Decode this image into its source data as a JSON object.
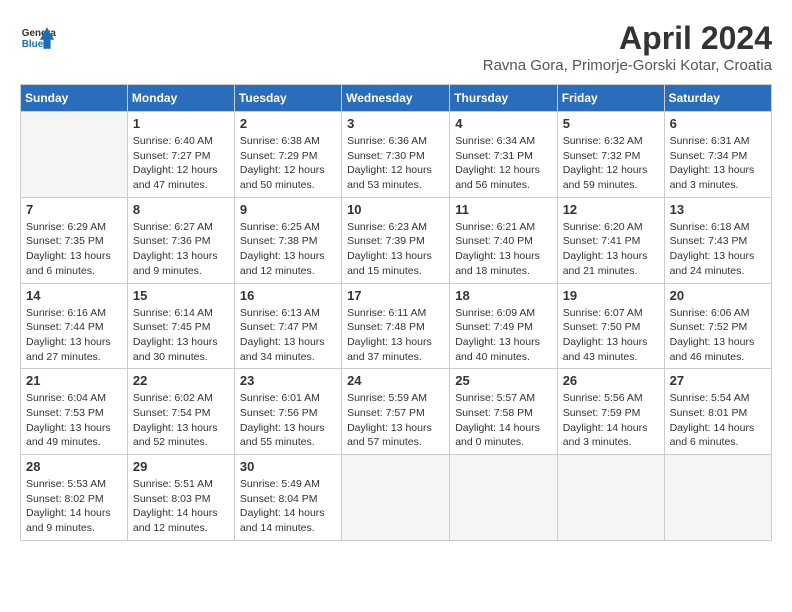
{
  "header": {
    "logo_line1": "General",
    "logo_line2": "Blue",
    "month": "April 2024",
    "location": "Ravna Gora, Primorje-Gorski Kotar, Croatia"
  },
  "days_of_week": [
    "Sunday",
    "Monday",
    "Tuesday",
    "Wednesday",
    "Thursday",
    "Friday",
    "Saturday"
  ],
  "weeks": [
    [
      {
        "day": "",
        "info": ""
      },
      {
        "day": "1",
        "info": "Sunrise: 6:40 AM\nSunset: 7:27 PM\nDaylight: 12 hours\nand 47 minutes."
      },
      {
        "day": "2",
        "info": "Sunrise: 6:38 AM\nSunset: 7:29 PM\nDaylight: 12 hours\nand 50 minutes."
      },
      {
        "day": "3",
        "info": "Sunrise: 6:36 AM\nSunset: 7:30 PM\nDaylight: 12 hours\nand 53 minutes."
      },
      {
        "day": "4",
        "info": "Sunrise: 6:34 AM\nSunset: 7:31 PM\nDaylight: 12 hours\nand 56 minutes."
      },
      {
        "day": "5",
        "info": "Sunrise: 6:32 AM\nSunset: 7:32 PM\nDaylight: 12 hours\nand 59 minutes."
      },
      {
        "day": "6",
        "info": "Sunrise: 6:31 AM\nSunset: 7:34 PM\nDaylight: 13 hours\nand 3 minutes."
      }
    ],
    [
      {
        "day": "7",
        "info": "Sunrise: 6:29 AM\nSunset: 7:35 PM\nDaylight: 13 hours\nand 6 minutes."
      },
      {
        "day": "8",
        "info": "Sunrise: 6:27 AM\nSunset: 7:36 PM\nDaylight: 13 hours\nand 9 minutes."
      },
      {
        "day": "9",
        "info": "Sunrise: 6:25 AM\nSunset: 7:38 PM\nDaylight: 13 hours\nand 12 minutes."
      },
      {
        "day": "10",
        "info": "Sunrise: 6:23 AM\nSunset: 7:39 PM\nDaylight: 13 hours\nand 15 minutes."
      },
      {
        "day": "11",
        "info": "Sunrise: 6:21 AM\nSunset: 7:40 PM\nDaylight: 13 hours\nand 18 minutes."
      },
      {
        "day": "12",
        "info": "Sunrise: 6:20 AM\nSunset: 7:41 PM\nDaylight: 13 hours\nand 21 minutes."
      },
      {
        "day": "13",
        "info": "Sunrise: 6:18 AM\nSunset: 7:43 PM\nDaylight: 13 hours\nand 24 minutes."
      }
    ],
    [
      {
        "day": "14",
        "info": "Sunrise: 6:16 AM\nSunset: 7:44 PM\nDaylight: 13 hours\nand 27 minutes."
      },
      {
        "day": "15",
        "info": "Sunrise: 6:14 AM\nSunset: 7:45 PM\nDaylight: 13 hours\nand 30 minutes."
      },
      {
        "day": "16",
        "info": "Sunrise: 6:13 AM\nSunset: 7:47 PM\nDaylight: 13 hours\nand 34 minutes."
      },
      {
        "day": "17",
        "info": "Sunrise: 6:11 AM\nSunset: 7:48 PM\nDaylight: 13 hours\nand 37 minutes."
      },
      {
        "day": "18",
        "info": "Sunrise: 6:09 AM\nSunset: 7:49 PM\nDaylight: 13 hours\nand 40 minutes."
      },
      {
        "day": "19",
        "info": "Sunrise: 6:07 AM\nSunset: 7:50 PM\nDaylight: 13 hours\nand 43 minutes."
      },
      {
        "day": "20",
        "info": "Sunrise: 6:06 AM\nSunset: 7:52 PM\nDaylight: 13 hours\nand 46 minutes."
      }
    ],
    [
      {
        "day": "21",
        "info": "Sunrise: 6:04 AM\nSunset: 7:53 PM\nDaylight: 13 hours\nand 49 minutes."
      },
      {
        "day": "22",
        "info": "Sunrise: 6:02 AM\nSunset: 7:54 PM\nDaylight: 13 hours\nand 52 minutes."
      },
      {
        "day": "23",
        "info": "Sunrise: 6:01 AM\nSunset: 7:56 PM\nDaylight: 13 hours\nand 55 minutes."
      },
      {
        "day": "24",
        "info": "Sunrise: 5:59 AM\nSunset: 7:57 PM\nDaylight: 13 hours\nand 57 minutes."
      },
      {
        "day": "25",
        "info": "Sunrise: 5:57 AM\nSunset: 7:58 PM\nDaylight: 14 hours\nand 0 minutes."
      },
      {
        "day": "26",
        "info": "Sunrise: 5:56 AM\nSunset: 7:59 PM\nDaylight: 14 hours\nand 3 minutes."
      },
      {
        "day": "27",
        "info": "Sunrise: 5:54 AM\nSunset: 8:01 PM\nDaylight: 14 hours\nand 6 minutes."
      }
    ],
    [
      {
        "day": "28",
        "info": "Sunrise: 5:53 AM\nSunset: 8:02 PM\nDaylight: 14 hours\nand 9 minutes."
      },
      {
        "day": "29",
        "info": "Sunrise: 5:51 AM\nSunset: 8:03 PM\nDaylight: 14 hours\nand 12 minutes."
      },
      {
        "day": "30",
        "info": "Sunrise: 5:49 AM\nSunset: 8:04 PM\nDaylight: 14 hours\nand 14 minutes."
      },
      {
        "day": "",
        "info": ""
      },
      {
        "day": "",
        "info": ""
      },
      {
        "day": "",
        "info": ""
      },
      {
        "day": "",
        "info": ""
      }
    ]
  ]
}
